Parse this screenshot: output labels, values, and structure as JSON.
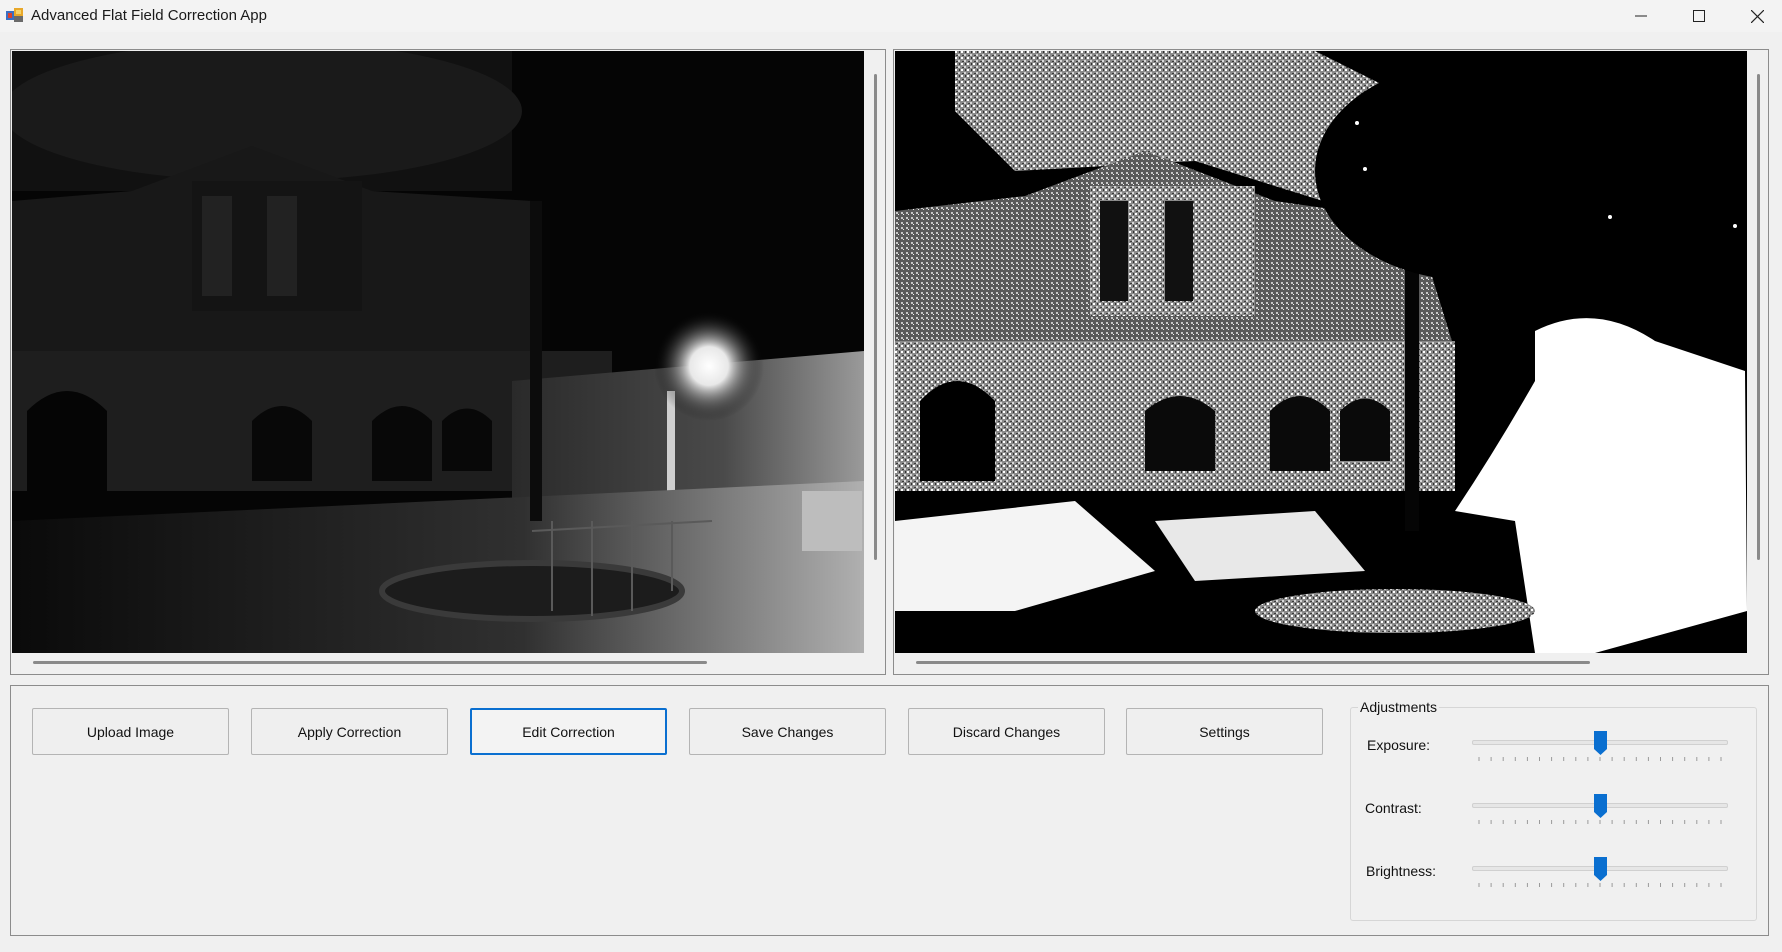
{
  "window": {
    "title": "Advanced Flat Field Correction App"
  },
  "toolbar": {
    "upload_label": "Upload Image",
    "apply_label": "Apply Correction",
    "edit_label": "Edit Correction",
    "save_label": "Save Changes",
    "discard_label": "Discard Changes",
    "settings_label": "Settings"
  },
  "adjustments": {
    "title": "Adjustments",
    "exposure": {
      "label": "Exposure:",
      "value": 0.5
    },
    "contrast": {
      "label": "Contrast:",
      "value": 0.5
    },
    "brightness": {
      "label": "Brightness:",
      "value": 0.5
    }
  },
  "icons": {
    "app": "app-icon",
    "minimize": "minimize-icon",
    "maximize": "maximize-icon",
    "close": "close-icon"
  },
  "colors": {
    "accent": "#0a6fd0",
    "background": "#f0f0f0",
    "border": "#8c8c8c"
  }
}
